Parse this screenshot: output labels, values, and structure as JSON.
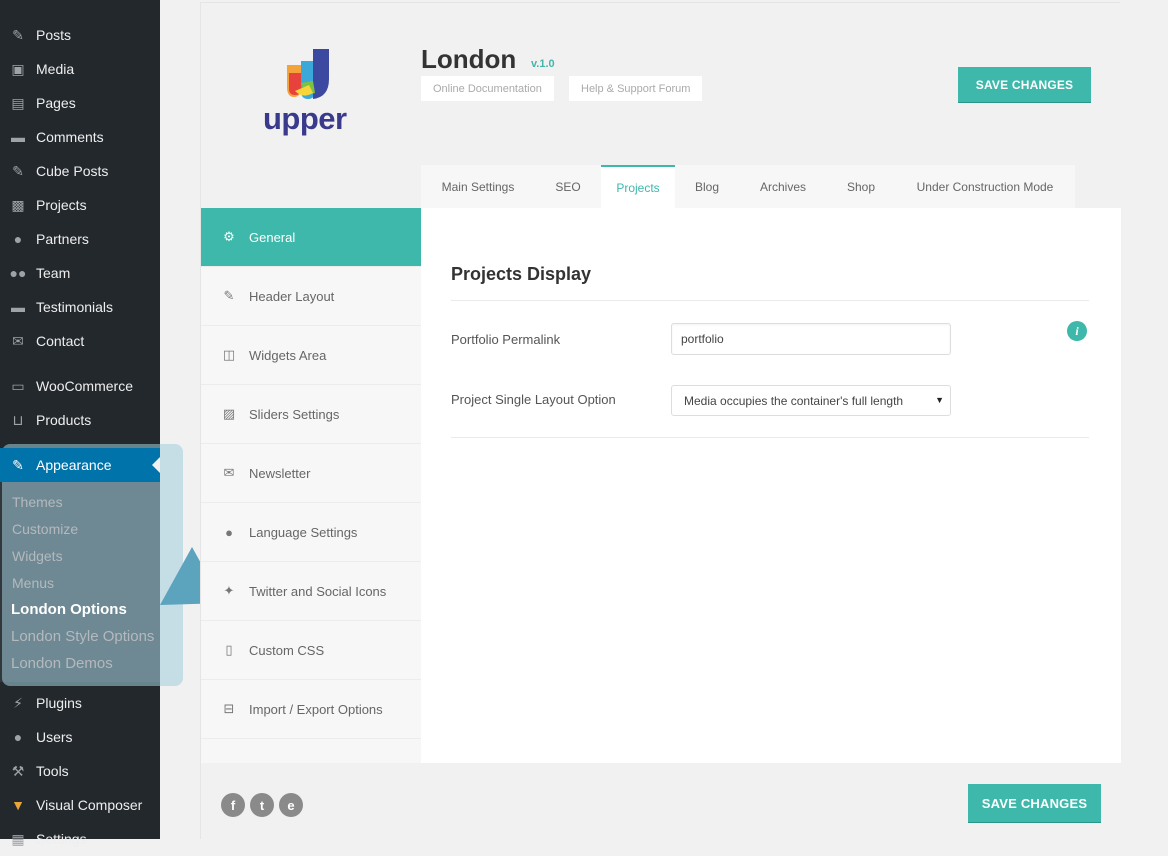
{
  "wp_menu": {
    "items": [
      {
        "label": "Posts",
        "icon": "pin-icon"
      },
      {
        "label": "Media",
        "icon": "media-icon"
      },
      {
        "label": "Pages",
        "icon": "pages-icon"
      },
      {
        "label": "Comments",
        "icon": "comment-icon"
      },
      {
        "label": "Cube Posts",
        "icon": "pin-icon"
      },
      {
        "label": "Projects",
        "icon": "image-icon"
      },
      {
        "label": "Partners",
        "icon": "user-icon"
      },
      {
        "label": "Team",
        "icon": "group-icon"
      },
      {
        "label": "Testimonials",
        "icon": "comment-icon"
      },
      {
        "label": "Contact",
        "icon": "mail-icon"
      },
      {
        "label": "WooCommerce",
        "icon": "woo-icon"
      },
      {
        "label": "Products",
        "icon": "cart-icon"
      },
      {
        "label": "Appearance",
        "icon": "brush-icon"
      },
      {
        "label": "Plugins",
        "icon": "plug-icon"
      },
      {
        "label": "Users",
        "icon": "user-icon"
      },
      {
        "label": "Tools",
        "icon": "wrench-icon"
      },
      {
        "label": "Visual Composer",
        "icon": "vc-icon"
      },
      {
        "label": "Settings",
        "icon": "settings-icon"
      }
    ],
    "appearance_submenu": [
      "Themes",
      "Customize",
      "Widgets",
      "Menus",
      "London Options",
      "London Style Options",
      "London Demos"
    ]
  },
  "header": {
    "logo_text": "upper",
    "title": "London",
    "version": "v.1.0",
    "links": [
      "Online Documentation",
      "Help & Support Forum"
    ],
    "save_label": "SAVE CHANGES"
  },
  "tabs": [
    "Main Settings",
    "SEO",
    "Projects",
    "Blog",
    "Archives",
    "Shop",
    "Under Construction Mode"
  ],
  "subnav": [
    {
      "label": "General",
      "icon": "gears-icon"
    },
    {
      "label": "Header Layout",
      "icon": "edit-icon"
    },
    {
      "label": "Widgets Area",
      "icon": "columns-icon"
    },
    {
      "label": "Sliders Settings",
      "icon": "picture-icon"
    },
    {
      "label": "Newsletter",
      "icon": "envelope-icon"
    },
    {
      "label": "Language Settings",
      "icon": "globe-icon"
    },
    {
      "label": "Twitter and Social Icons",
      "icon": "twitter-icon"
    },
    {
      "label": "Custom CSS",
      "icon": "code-file-icon"
    },
    {
      "label": "Import / Export Options",
      "icon": "drive-icon"
    }
  ],
  "content": {
    "section_title": "Projects Display",
    "permalink_label": "Portfolio Permalink",
    "permalink_value": "portfolio",
    "layout_label": "Project Single Layout Option",
    "layout_value": "Media occupies the container's full length"
  },
  "footer": {
    "save_label": "SAVE CHANGES",
    "social": [
      "f",
      "t",
      "e"
    ]
  },
  "colors": {
    "accent": "#3db8aa",
    "wp_sidebar": "#23282d",
    "wp_active": "#0073aa"
  }
}
